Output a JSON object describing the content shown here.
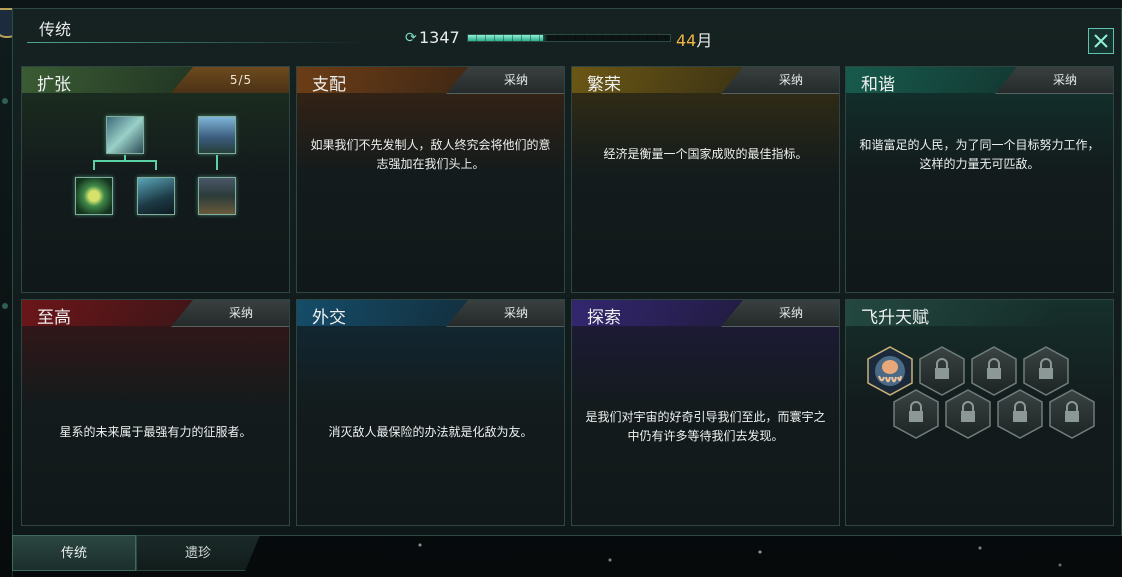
{
  "window": {
    "title": "传统",
    "unity_value": "1347",
    "unity_progress": 0.37,
    "months_number": "44",
    "months_unit": "月"
  },
  "cards": [
    {
      "id": "expansion",
      "title": "扩张",
      "status": "5/5",
      "description": "",
      "accent": "#b86a1f"
    },
    {
      "id": "domination",
      "title": "支配",
      "status": "采纳",
      "description": "如果我们不先发制人，敌人终究会将他们的意志强加在我们头上。",
      "accent": "#b8641a"
    },
    {
      "id": "prosperity",
      "title": "繁荣",
      "status": "采纳",
      "description": "经济是衡量一个国家成败的最佳指标。",
      "accent": "#a88a18"
    },
    {
      "id": "harmony",
      "title": "和谐",
      "status": "采纳",
      "description": "和谐富足的人民，为了同一个目标努力工作，这样的力量无可匹敌。",
      "accent": "#1f8e74"
    },
    {
      "id": "supremacy",
      "title": "至高",
      "status": "采纳",
      "description": "星系的未来属于最强有力的征服者。",
      "accent": "#a61e26"
    },
    {
      "id": "diplomacy",
      "title": "外交",
      "status": "采纳",
      "description": "消灭敌人最保险的办法就是化敌为友。",
      "accent": "#1e6f98"
    },
    {
      "id": "discovery",
      "title": "探索",
      "status": "采纳",
      "description": "是我们对宇宙的好奇引导我们至此，而寰宇之中仍有许多等待我们去发现。",
      "accent": "#4a37a0"
    },
    {
      "id": "ascension",
      "title": "飞升天赋",
      "status": "",
      "description": "",
      "accent": "#2e5e52"
    }
  ],
  "ascension_slots": {
    "unlocked": 1,
    "locked": 7
  },
  "bottom_tabs": [
    {
      "label": "传统",
      "active": true
    },
    {
      "label": "遗珍",
      "active": false
    }
  ]
}
